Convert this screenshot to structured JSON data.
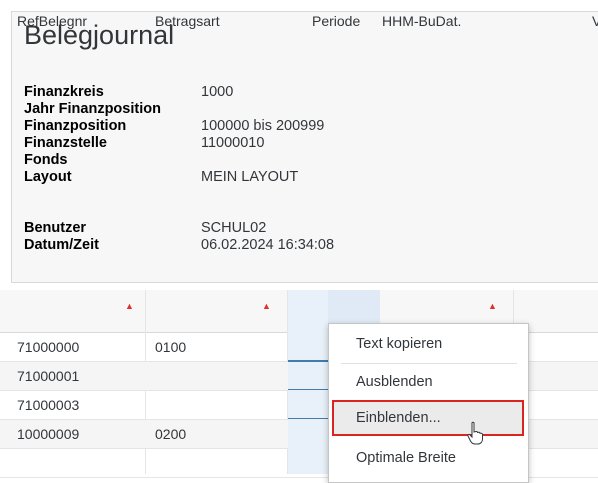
{
  "header": {
    "title": "Belegjournal",
    "fields": [
      {
        "label": "Finanzkreis",
        "value": "1000"
      },
      {
        "label": "Jahr Finanzposition",
        "value": ""
      },
      {
        "label": "Finanzposition",
        "value": "100000 bis 200999"
      },
      {
        "label": "Finanzstelle",
        "value": "11000010"
      },
      {
        "label": "Fonds",
        "value": ""
      },
      {
        "label": "Layout",
        "value": "MEIN LAYOUT"
      },
      {
        "label": "Benutzer",
        "value": "SCHUL02"
      },
      {
        "label": "Datum/Zeit",
        "value": "06.02.2024 16:34:08"
      }
    ]
  },
  "table": {
    "columns": [
      "RefBelegnr",
      "Betragsart",
      "Periode",
      "HHM-BuDat.",
      "V"
    ],
    "rows": [
      {
        "refbelegnr": "71000000",
        "betragsart": "0100"
      },
      {
        "refbelegnr": "71000001",
        "betragsart": ""
      },
      {
        "refbelegnr": "71000003",
        "betragsart": ""
      },
      {
        "refbelegnr": "10000009",
        "betragsart": "0200"
      },
      {
        "refbelegnr": "",
        "betragsart": ""
      }
    ]
  },
  "context_menu": {
    "items": [
      "Text kopieren",
      "Ausblenden",
      "Einblenden...",
      "Optimale Breite"
    ]
  },
  "icons": {
    "sort": "sort-ascending-icon",
    "cursor": "mouse-pointer-icon"
  },
  "colors": {
    "highlight_border": "#d9251d",
    "sort_icon": "#e0302a"
  }
}
